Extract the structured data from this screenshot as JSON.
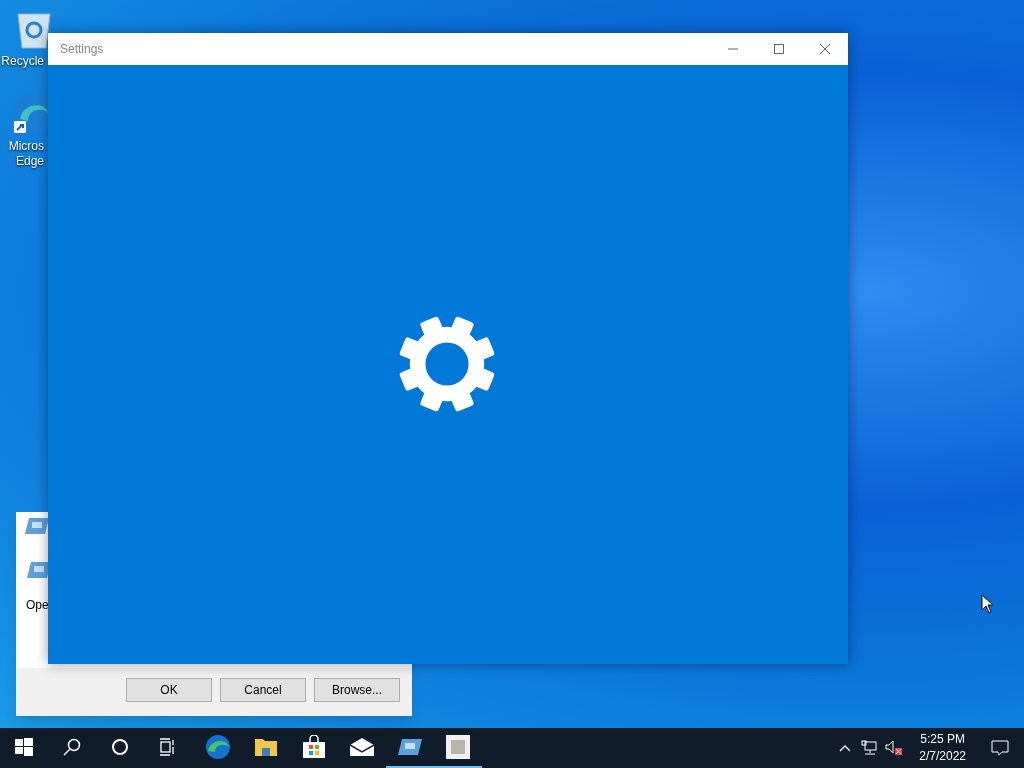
{
  "desktop_icons": [
    {
      "kind": "recycle-bin",
      "label": "Recycle"
    },
    {
      "kind": "edge",
      "label": "Micros\nEdge"
    }
  ],
  "run_dialog": {
    "label": "Ope",
    "buttons": [
      "OK",
      "Cancel",
      "Browse..."
    ]
  },
  "settings_window": {
    "title": "Settings"
  },
  "taskbar": {
    "apps": [
      {
        "kind": "start",
        "running": false
      },
      {
        "kind": "search",
        "running": false
      },
      {
        "kind": "cortana",
        "running": false
      },
      {
        "kind": "task-view",
        "running": false
      },
      {
        "kind": "edge",
        "running": false
      },
      {
        "kind": "folder",
        "running": false
      },
      {
        "kind": "store",
        "running": false
      },
      {
        "kind": "mail",
        "running": false
      },
      {
        "kind": "run",
        "running": true
      },
      {
        "kind": "app",
        "running": true
      }
    ],
    "time": "5:25 PM",
    "date": "2/7/2022"
  }
}
